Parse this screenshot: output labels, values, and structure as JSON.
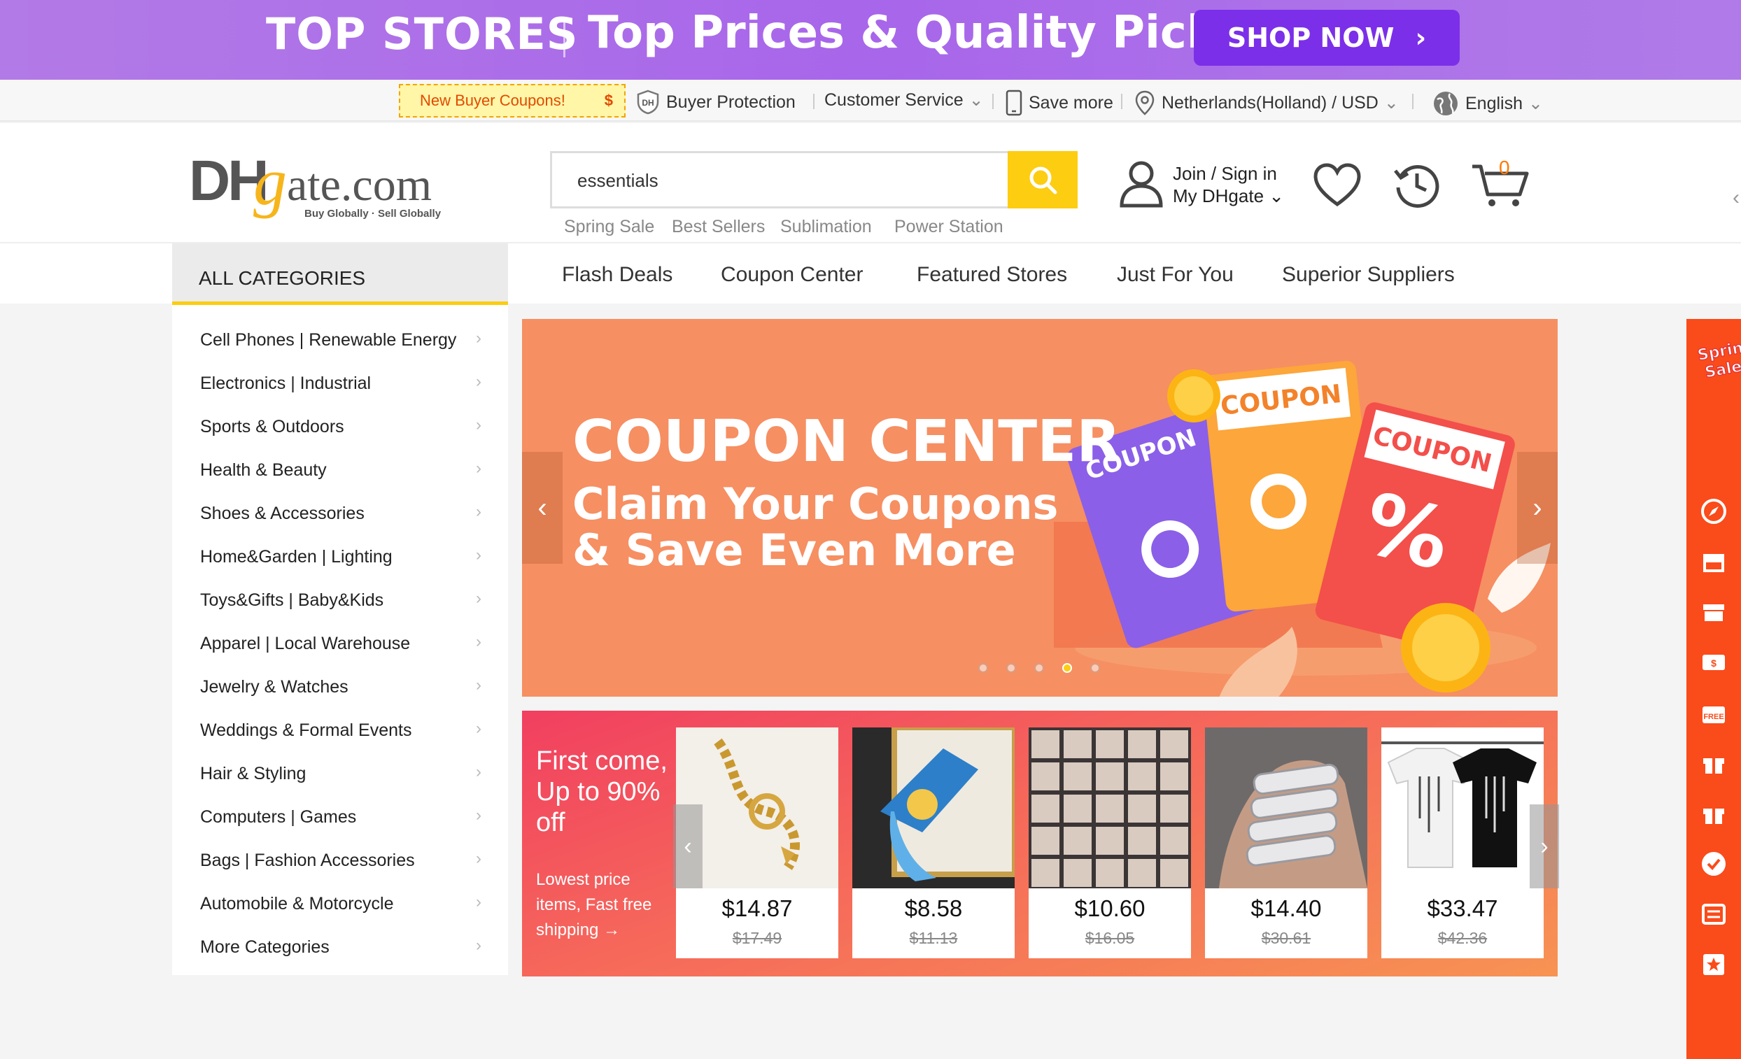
{
  "banner": {
    "title": "TOP STORES",
    "subtitle": "Top Prices & Quality Picks",
    "cta": "SHOP NOW"
  },
  "topbar": {
    "coupon": "New Buyer Coupons!",
    "coupon_symbol": "$",
    "buyer_protection": "Buyer Protection",
    "customer_service": "Customer Service",
    "save_more": "Save more",
    "region": "Netherlands(Holland) / USD",
    "language": "English"
  },
  "header": {
    "logo_main": "DHgate.com",
    "logo_tagline": "Buy Globally · Sell Globally",
    "search_value": "essentials",
    "hot_searches": [
      "Spring Sale",
      "Best Sellers",
      "Sublimation",
      "Power Station"
    ],
    "join": "Join / Sign in",
    "my_dhgate": "My DHgate",
    "cart_count": "0"
  },
  "nav": {
    "all_categories": "ALL CATEGORIES",
    "items": [
      "Flash Deals",
      "Coupon Center",
      "Featured Stores",
      "Just For You",
      "Superior Suppliers"
    ]
  },
  "categories": [
    "Cell Phones  |  Renewable Energy",
    "Electronics  |  Industrial",
    "Sports & Outdoors",
    "Health & Beauty",
    "Shoes & Accessories",
    "Home&Garden  |  Lighting",
    "Toys&Gifts  |  Baby&Kids",
    "Apparel  |  Local Warehouse",
    "Jewelry & Watches",
    "Weddings & Formal Events",
    "Hair & Styling",
    "Computers  |  Games",
    "Bags  |  Fashion Accessories",
    "Automobile & Motorcycle",
    "More Categories"
  ],
  "hero": {
    "title": "COUPON CENTER",
    "subtitle": "Claim Your Coupons & Save Even More",
    "coupon_word": "COUPON",
    "slide_count": 5,
    "active_slide": 4
  },
  "deals": {
    "title": "First come, Up to 90% off",
    "subtitle": "Lowest price items, Fast free shipping →",
    "products": [
      {
        "price": "$14.87",
        "old": "$17.49"
      },
      {
        "price": "$8.58",
        "old": "$11.13"
      },
      {
        "price": "$10.60",
        "old": "$16.05"
      },
      {
        "price": "$14.40",
        "old": "$30.61"
      },
      {
        "price": "$33.47",
        "old": "$42.36"
      }
    ]
  },
  "rightbar": {
    "badge": "Spring Sale",
    "icons": [
      "compass-icon",
      "store-icon",
      "store-icon",
      "coupon-icon",
      "free-shipping-icon",
      "gift-icon",
      "gift-icon",
      "check-icon",
      "list-icon",
      "favorite-icon"
    ],
    "free_label": "FREE"
  }
}
